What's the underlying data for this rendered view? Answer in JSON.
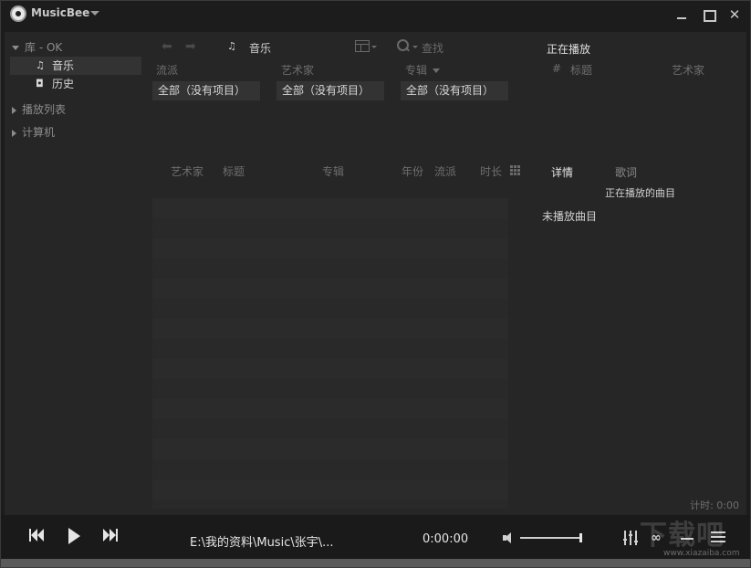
{
  "app": {
    "title": "MusicBee"
  },
  "window_controls": {
    "close_glyph": "✕"
  },
  "sidebar": {
    "library_label": "库 - OK",
    "items": [
      {
        "icon": "music-note-icon",
        "glyph": "♫",
        "label": "音乐"
      },
      {
        "icon": "history-icon",
        "glyph": "◘",
        "label": "历史"
      }
    ],
    "playlists_label": "播放列表",
    "computer_label": "计算机"
  },
  "toolbar": {
    "back_glyph": "⬅",
    "forward_glyph": "➡",
    "breadcrumb_glyph": "♫",
    "breadcrumb": "音乐",
    "search_label": "查找"
  },
  "filters": {
    "panels": [
      {
        "header": "流派",
        "value": "全部（没有项目）"
      },
      {
        "header": "艺术家",
        "value": "全部（没有项目）"
      },
      {
        "header": "专辑",
        "value": "全部（没有项目）"
      }
    ]
  },
  "track_list": {
    "columns": [
      "艺术家",
      "标题",
      "专辑",
      "年份",
      "流派",
      "时长"
    ]
  },
  "now_playing_panel": {
    "title": "正在播放",
    "columns": [
      "#",
      "标题",
      "艺术家"
    ],
    "tabs": [
      "详情",
      "歌词"
    ],
    "subtitle": "正在播放的曲目",
    "empty_text": "未播放曲目",
    "timer": "计时: 0:00"
  },
  "player": {
    "path": "E:\\我的资料\\Music\\张宇\\...",
    "time": "0:00:00",
    "volume": 0.97,
    "scrobble_glyph": "∞"
  },
  "watermark": {
    "main": "下载吧",
    "url": "www.xiazaiba.com"
  },
  "colors": {
    "background": "#1c1c1c",
    "panel": "#262626",
    "selected": "#333333",
    "text": "#c8c8c8"
  }
}
